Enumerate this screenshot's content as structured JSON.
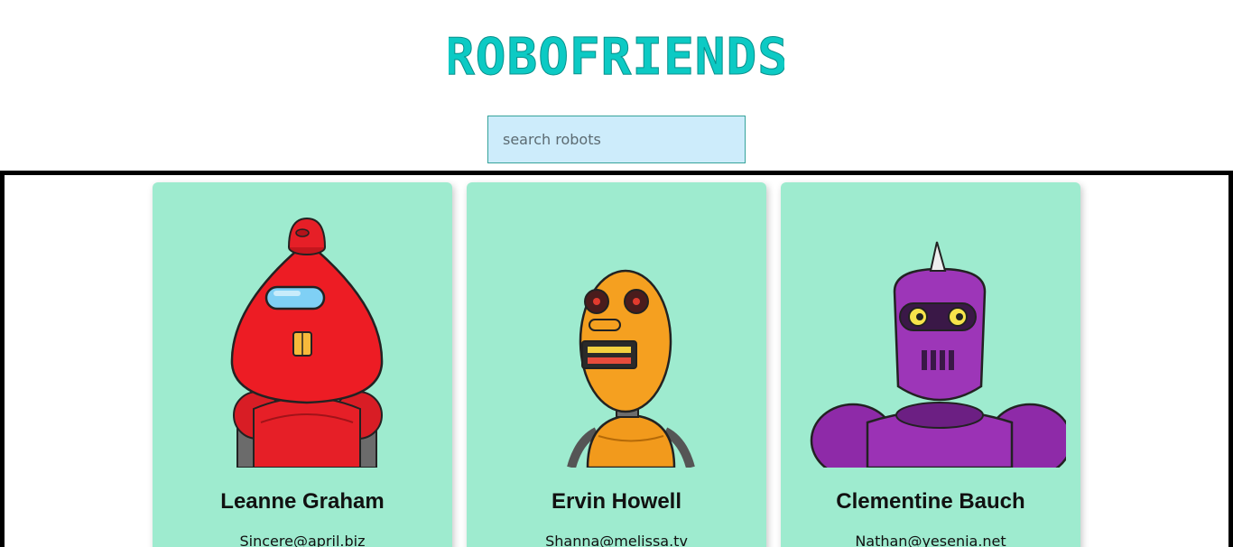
{
  "header": {
    "logo_text": "ROBOFRIENDS",
    "logo_color": "#0ccac4"
  },
  "search": {
    "placeholder": "search robots",
    "value": ""
  },
  "robots": [
    {
      "name": "Leanne Graham",
      "email": "Sincere@april.biz",
      "image_icon": "red-robot-avatar"
    },
    {
      "name": "Ervin Howell",
      "email": "Shanna@melissa.tv",
      "image_icon": "orange-robot-avatar"
    },
    {
      "name": "Clementine Bauch",
      "email": "Nathan@yesenia.net",
      "image_icon": "purple-robot-avatar"
    }
  ],
  "colors": {
    "card_background": "#9eebcf",
    "search_background": "#cdecfb",
    "border": "#000000"
  }
}
